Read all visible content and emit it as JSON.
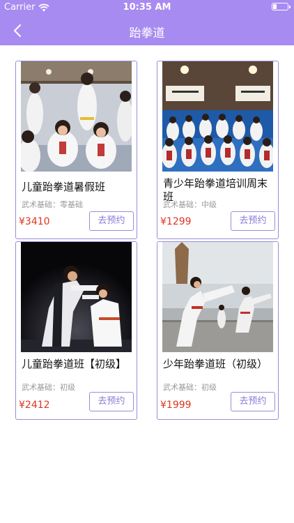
{
  "status_bar": {
    "carrier": "Carrier",
    "time": "10:35 AM"
  },
  "nav": {
    "title": "跆拳道",
    "back_icon": "chevron-left-icon"
  },
  "colors": {
    "accent": "#a78bf0",
    "border": "#9a8cd8",
    "price": "#e0341f",
    "muted": "#999999"
  },
  "courses": [
    {
      "name": "儿童跆拳道暑假班",
      "level_label": "武术基础：",
      "level": "零基础",
      "price": "¥3410",
      "button": "去预约"
    },
    {
      "name": "青少年跆拳道培训周末班",
      "level_label": "武术基础：",
      "level": "中级",
      "price": "¥1299",
      "button": "去预约"
    },
    {
      "name": "儿童跆拳道班【初级】",
      "level_label": "武术基础：",
      "level": "初级",
      "price": "¥2412",
      "button": "去预约"
    },
    {
      "name": "少年跆拳道班（初级）",
      "level_label": "武术基础：",
      "level": "初级",
      "price": "¥1999",
      "button": "去预约"
    }
  ]
}
